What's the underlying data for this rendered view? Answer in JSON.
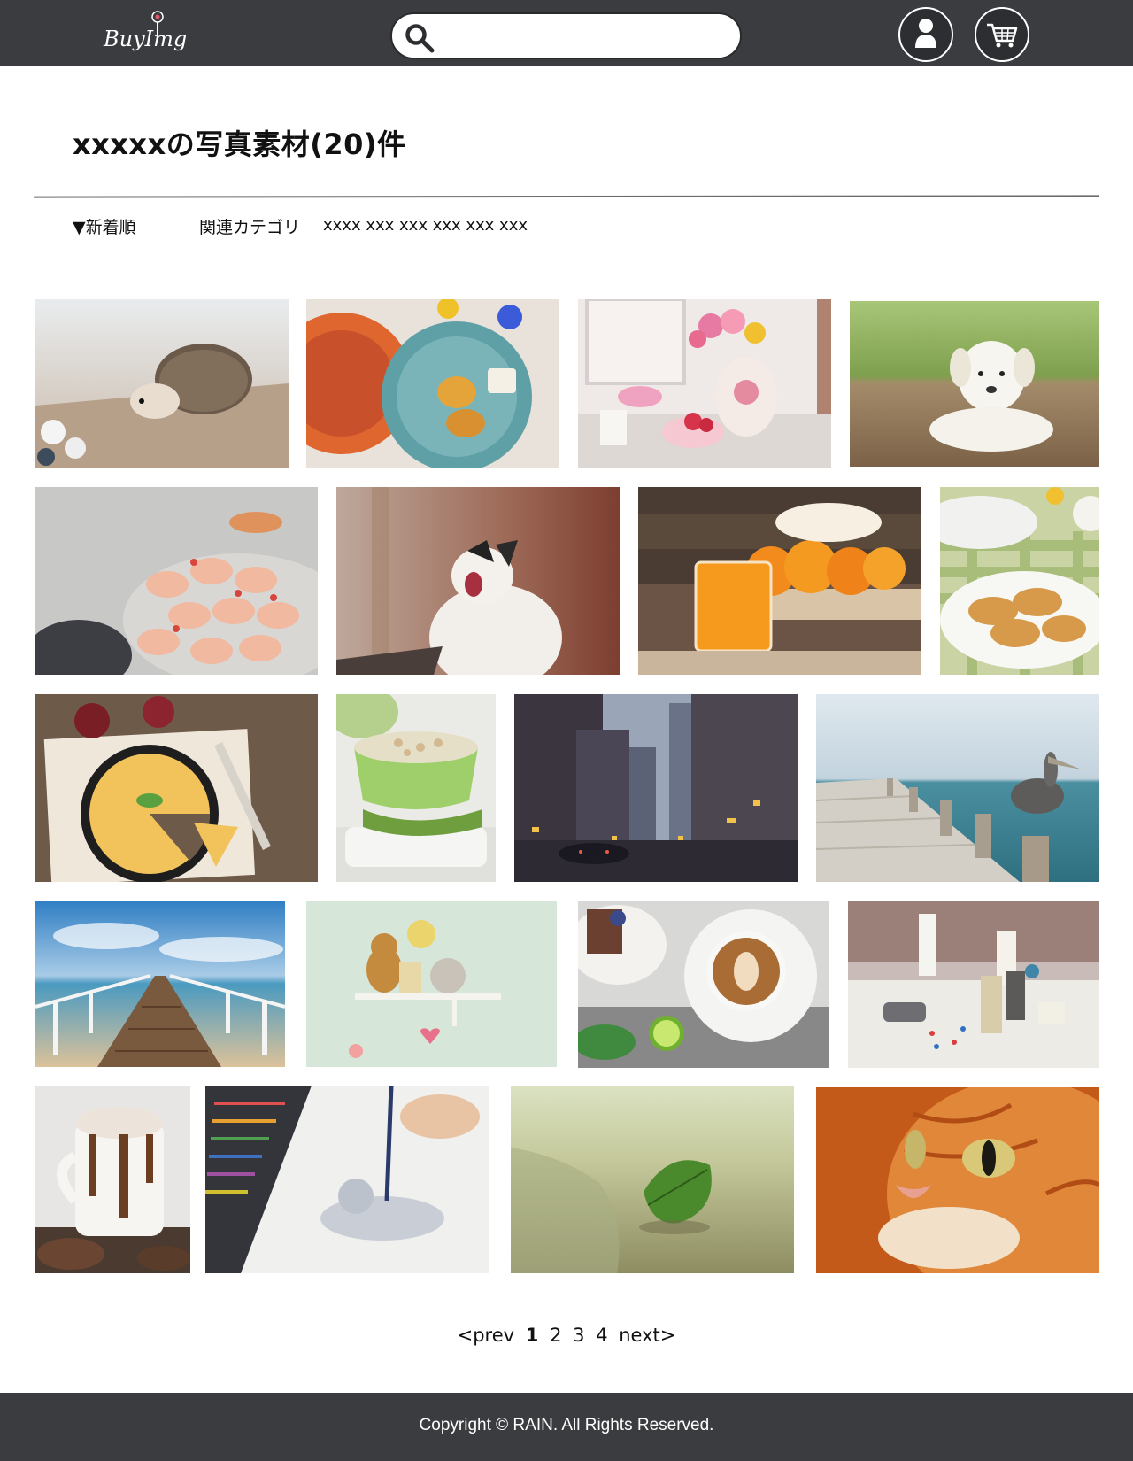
{
  "header": {
    "logo_text": "BuyImg",
    "search_placeholder": "",
    "user_icon": "user-icon",
    "cart_icon": "cart-icon",
    "colors": {
      "bar": "#3b3c40",
      "text": "#ffffff"
    }
  },
  "main": {
    "title": "xxxxxの写真素材(20)件",
    "sort_label": "▼新着順",
    "related_label": "関連カテゴリ",
    "related_tags": "xxxx xxx xxx xxx xxx xxx"
  },
  "photos": [
    {
      "subject": "hedgehog"
    },
    {
      "subject": "plates-pancakes"
    },
    {
      "subject": "flowers-table"
    },
    {
      "subject": "white-puppy"
    },
    {
      "subject": "macarons"
    },
    {
      "subject": "yawning-cat"
    },
    {
      "subject": "orange-juice"
    },
    {
      "subject": "cookies-plate"
    },
    {
      "subject": "quiche"
    },
    {
      "subject": "green-bowl"
    },
    {
      "subject": "city-street"
    },
    {
      "subject": "pelican-pier"
    },
    {
      "subject": "wooden-pier"
    },
    {
      "subject": "teddy-shelf"
    },
    {
      "subject": "latte-coffee"
    },
    {
      "subject": "thread-spools"
    },
    {
      "subject": "hot-chocolate"
    },
    {
      "subject": "cat-drawing"
    },
    {
      "subject": "leaf-beach"
    },
    {
      "subject": "orange-cat"
    }
  ],
  "pagination": {
    "prev": "<prev",
    "pages": [
      "1",
      "2",
      "3",
      "4"
    ],
    "current": "1",
    "next": "next>"
  },
  "footer": {
    "copyright": "Copyright © RAIN. All Rights Reserved."
  }
}
